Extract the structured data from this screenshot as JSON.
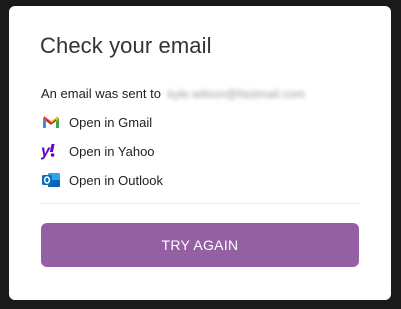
{
  "dialog": {
    "title": "Check your email",
    "sent_prefix": "An email was sent to",
    "email": "kyle.wilson@fastmail.com"
  },
  "providers": [
    {
      "label": "Open in Gmail",
      "icon": "gmail-icon"
    },
    {
      "label": "Open in Yahoo",
      "icon": "yahoo-icon"
    },
    {
      "label": "Open in Outlook",
      "icon": "outlook-icon"
    }
  ],
  "actions": {
    "try_again": "TRY AGAIN"
  },
  "colors": {
    "button": "#9560a3",
    "yahoo": "#6001d2",
    "outlook": "#0f6cbd"
  }
}
